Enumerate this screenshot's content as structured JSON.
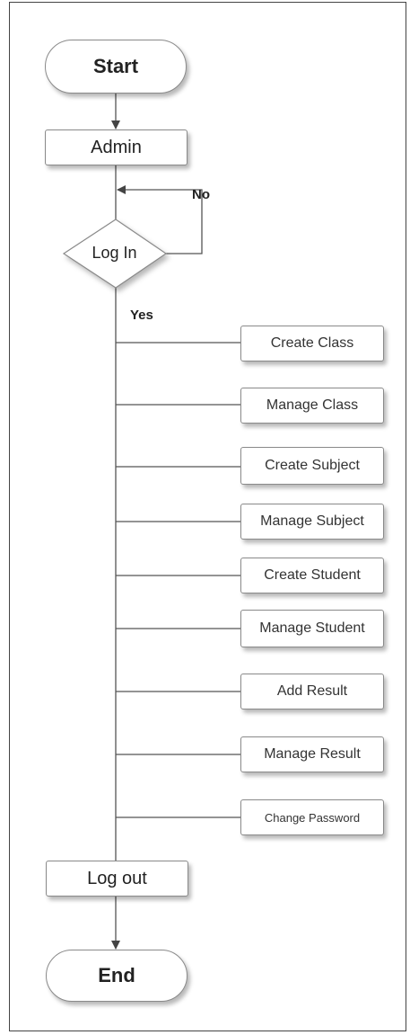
{
  "diagram": {
    "start": "Start",
    "admin": "Admin",
    "login": "Log In",
    "no_label": "No",
    "yes_label": "Yes",
    "tasks": [
      "Create Class",
      "Manage Class",
      "Create Subject",
      "Manage Subject",
      "Create Student",
      "Manage Student",
      "Add Result",
      "Manage Result",
      "Change Password"
    ],
    "logout": "Log out",
    "end": "End"
  },
  "colors": {
    "line": "#555555",
    "box_border": "#8a8a8a",
    "frame": "#444444"
  }
}
